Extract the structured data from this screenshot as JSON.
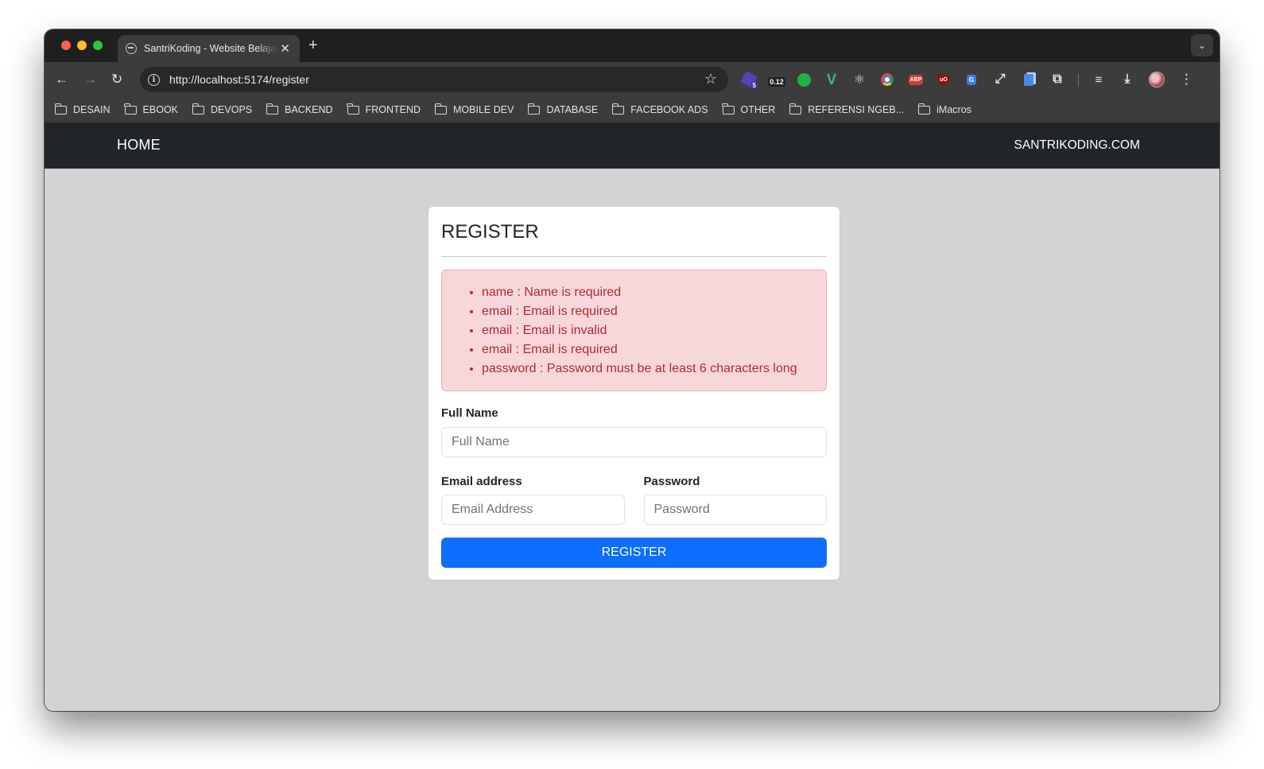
{
  "browser": {
    "tab_title": "SantriKoding - Website Belajar",
    "tab_close": "✕",
    "new_tab": "+",
    "url": "http://localhost:5174/register",
    "extensions": {
      "badge_count": "5",
      "timer_value": "0.12",
      "abp_label": "ABP",
      "ublock_label": "uO",
      "translate_label": "G"
    },
    "bookmarks": [
      "DESAIN",
      "EBOOK",
      "DEVOPS",
      "BACKEND",
      "FRONTEND",
      "MOBILE DEV",
      "DATABASE",
      "FACEBOOK ADS",
      "OTHER",
      "REFERENSI NGEB...",
      "iMacros"
    ]
  },
  "navbar": {
    "home_label": "HOME",
    "site_label": "SANTRIKODING.COM"
  },
  "register": {
    "title": "REGISTER",
    "errors": [
      "name : Name is required",
      "email : Email is required",
      "email : Email is invalid",
      "email : Email is required",
      "password : Password must be at least 6 characters long"
    ],
    "full_name_label": "Full Name",
    "full_name_placeholder": "Full Name",
    "full_name_value": "",
    "email_label": "Email address",
    "email_placeholder": "Email Address",
    "email_value": "",
    "password_label": "Password",
    "password_placeholder": "Password",
    "password_value": "",
    "submit_label": "REGISTER"
  },
  "colors": {
    "navbar_bg": "#212529",
    "page_bg": "#d3d3d3",
    "alert_bg": "#f8d7da",
    "alert_text": "#b02a37",
    "primary": "#0d6efd"
  }
}
